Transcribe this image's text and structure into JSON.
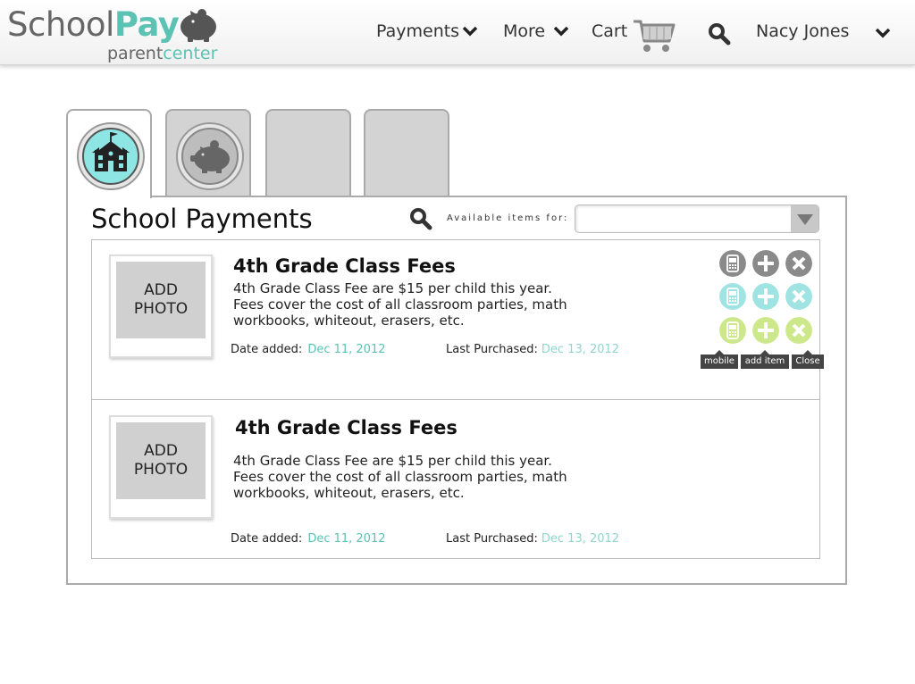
{
  "header": {
    "logo": {
      "word1": "School",
      "word2": "Pay",
      "sub1": "parent",
      "sub2": "center"
    },
    "nav": {
      "payments_label": "Payments",
      "more_label": "More",
      "cart_label": "Cart",
      "user_label": "Nacy Jones"
    }
  },
  "panel": {
    "title": "School Payments",
    "available_label": "Available items for:",
    "select_value": ""
  },
  "items": [
    {
      "photo_label": "ADD PHOTO",
      "title": "4th Grade Class Fees",
      "description": "4th Grade Class Fee are $15 per child this year. Fees cover the cost of all classroom parties, math workbooks, whiteout, erasers, etc.",
      "date_added_label": "Date added:",
      "date_added": "Dec 11, 2012",
      "last_purchased_label": "Last Purchased:",
      "last_purchased": "Dec 13, 2012"
    },
    {
      "photo_label": "ADD PHOTO",
      "title": "4th Grade Class Fees",
      "description": "4th Grade Class Fee are $15 per child this year. Fees cover the cost of all classroom parties, math workbooks, whiteout, erasers, etc.",
      "date_added_label": "Date added:",
      "date_added": "Dec 11, 2012",
      "last_purchased_label": "Last Purchased:",
      "last_purchased": "Dec 13, 2012"
    }
  ],
  "actions": {
    "tooltips": {
      "mobile": "mobile",
      "add": "add item",
      "close": "Close"
    }
  },
  "colors": {
    "brand_teal": "#5cc2b4",
    "action_gray": "#8a8a8a",
    "action_teal": "#9fe3e3",
    "action_green": "#cde88a"
  }
}
